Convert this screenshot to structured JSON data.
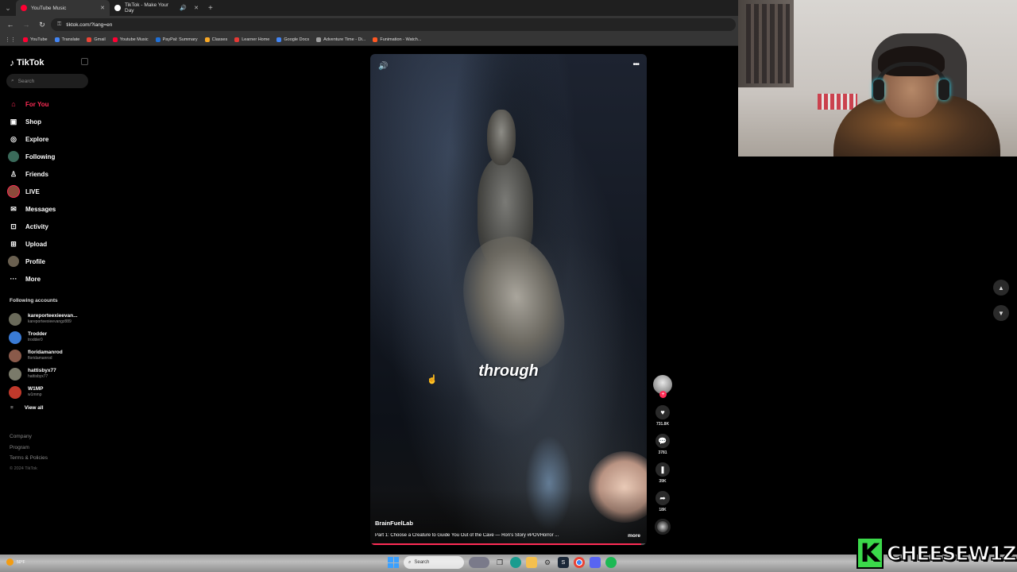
{
  "browser": {
    "tabs": [
      {
        "title": "YouTube Music",
        "color": "#ff0033",
        "active": true
      },
      {
        "title": "TikTok - Make Your Day",
        "color": "#ffffff",
        "active": false
      }
    ],
    "url": "tiktok.com/?lang=en",
    "bookmarks": [
      {
        "label": "YouTube",
        "color": "#ff0033"
      },
      {
        "label": "Translate",
        "color": "#4285f4"
      },
      {
        "label": "Gmail",
        "color": "#ea4335"
      },
      {
        "label": "Youtube Music",
        "color": "#ff0033"
      },
      {
        "label": "PayPal: Summary",
        "color": "#1f6fd6"
      },
      {
        "label": "Classes",
        "color": "#f9a825"
      },
      {
        "label": "Learner Home",
        "color": "#e53935"
      },
      {
        "label": "Google Docs",
        "color": "#4285f4"
      },
      {
        "label": "Adventure Time - Di...",
        "color": "#9e9e9e"
      },
      {
        "label": "Funimation - Watch...",
        "color": "#ff5722"
      }
    ]
  },
  "tiktok": {
    "logo": "TikTok",
    "search_placeholder": "Search",
    "menu": [
      {
        "label": "For You",
        "icon": "home-icon",
        "glyph": "⌂",
        "active": true
      },
      {
        "label": "Shop",
        "icon": "shop-icon",
        "glyph": "▣",
        "active": false
      },
      {
        "label": "Explore",
        "icon": "compass-icon",
        "glyph": "◎",
        "active": false
      },
      {
        "label": "Following",
        "icon": "following-avatar-icon",
        "glyph": "●",
        "active": false
      },
      {
        "label": "Friends",
        "icon": "friends-icon",
        "glyph": "♙",
        "active": false
      },
      {
        "label": "LIVE",
        "icon": "live-avatar-icon",
        "glyph": "●",
        "active": false
      },
      {
        "label": "Messages",
        "icon": "messages-icon",
        "glyph": "✉",
        "active": false
      },
      {
        "label": "Activity",
        "icon": "activity-icon",
        "glyph": "⊡",
        "active": false
      },
      {
        "label": "Upload",
        "icon": "upload-icon",
        "glyph": "⊞",
        "active": false
      },
      {
        "label": "Profile",
        "icon": "profile-avatar-icon",
        "glyph": "●",
        "active": false
      },
      {
        "label": "More",
        "icon": "more-icon",
        "glyph": "···",
        "active": false
      }
    ],
    "following_title": "Following accounts",
    "accounts": [
      {
        "name": "kareporteexieevan...",
        "handle": "kareporteexieevangz889",
        "color": "#6a6a5a"
      },
      {
        "name": "Trodder",
        "handle": "trodder0",
        "color": "#3a7bd5"
      },
      {
        "name": "floridamanrod",
        "handle": "floridamanrod",
        "color": "#8a5a4a"
      },
      {
        "name": "hattisbyx77",
        "handle": "hattisbyx77",
        "color": "#7a7a6a"
      },
      {
        "name": "W1MP",
        "handle": "w1mmp",
        "color": "#c0392b"
      }
    ],
    "view_all": "View all",
    "footer": {
      "company": "Company",
      "program": "Program",
      "terms": "Terms & Policies",
      "copyright": "© 2024 TikTok"
    }
  },
  "video": {
    "caption_word": "through",
    "author": "BrainFuelLab",
    "description": "Part 1: Choose a Creature to Guide You Out of the Cave — Ron's Story #POVHorror ...",
    "more": "more",
    "progress": 0.98,
    "likes": "731.8K",
    "comments": "3781",
    "saves": "39K",
    "shares": "18K"
  },
  "taskbar": {
    "search": "Search",
    "weather": "50°F"
  },
  "streamer": {
    "badge_letter": "K",
    "name": "CHEESEW1Z",
    "badge_color": "#3bd94a"
  }
}
